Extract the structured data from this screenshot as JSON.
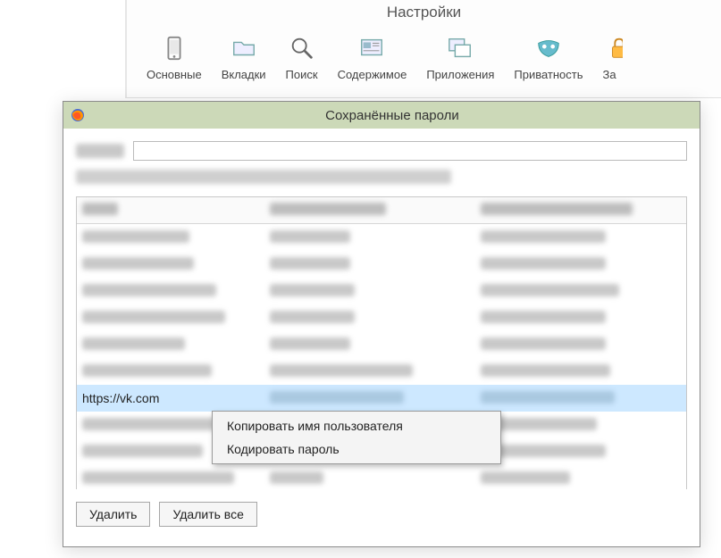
{
  "settings": {
    "title": "Настройки",
    "tabs": [
      {
        "label": "Основные",
        "icon": "phone-icon"
      },
      {
        "label": "Вкладки",
        "icon": "folder-icon"
      },
      {
        "label": "Поиск",
        "icon": "search-icon"
      },
      {
        "label": "Содержимое",
        "icon": "content-icon"
      },
      {
        "label": "Приложения",
        "icon": "windows-icon"
      },
      {
        "label": "Приватность",
        "icon": "mask-icon"
      },
      {
        "label": "За",
        "icon": "lock-icon"
      }
    ]
  },
  "dialog": {
    "title": "Сохранённые пароли",
    "columns": [
      "Сайт",
      "Имя пользователя",
      "Последнее использование"
    ],
    "selected_row": {
      "site": "https://vk.com"
    },
    "buttons": {
      "delete": "Удалить",
      "delete_all": "Удалить все"
    }
  },
  "context_menu": {
    "items": [
      "Копировать имя пользователя",
      "Кодировать пароль"
    ]
  }
}
